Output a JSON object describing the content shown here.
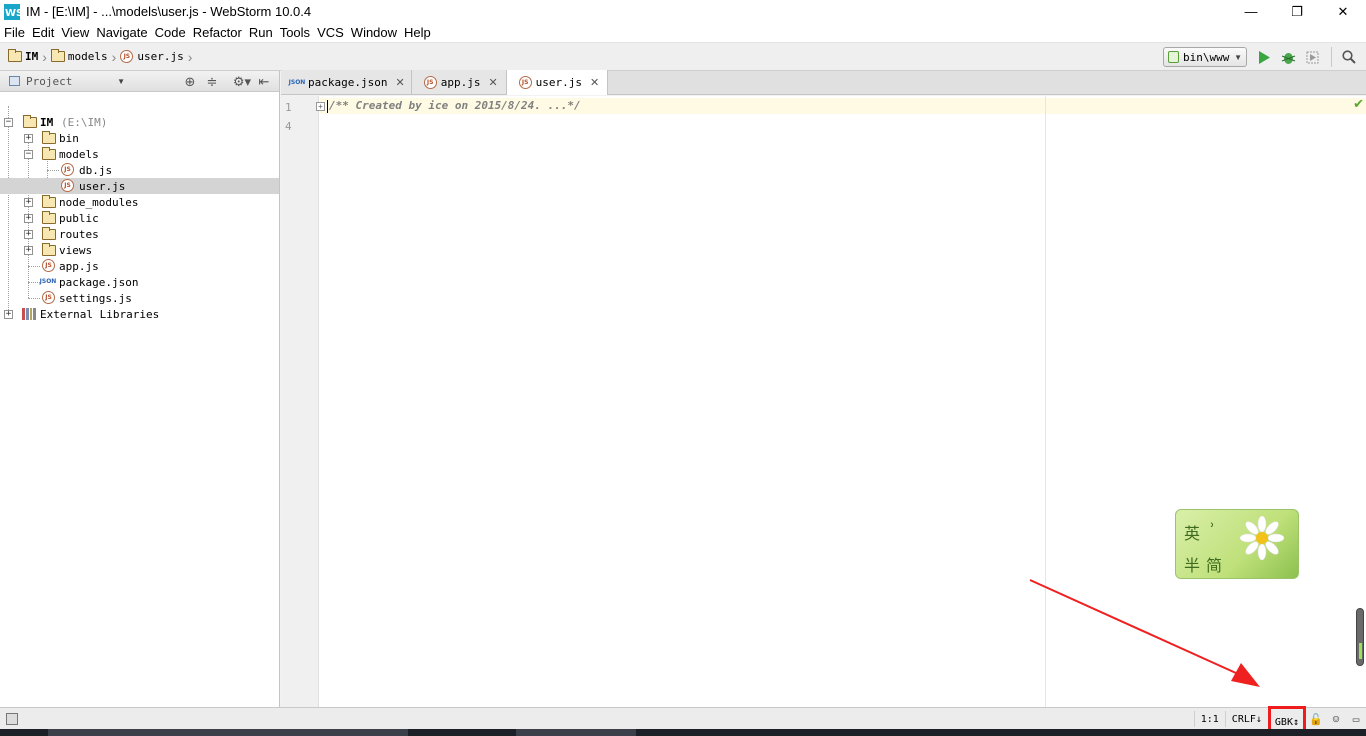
{
  "window": {
    "title": "IM - [E:\\IM] - ...\\models\\user.js - WebStorm 10.0.4",
    "controls": {
      "minimize": "—",
      "restore": "❐",
      "close": "✕"
    }
  },
  "menu": [
    "File",
    "Edit",
    "View",
    "Navigate",
    "Code",
    "Refactor",
    "Run",
    "Tools",
    "VCS",
    "Window",
    "Help"
  ],
  "breadcrumb": [
    "IM",
    "models",
    "user.js"
  ],
  "run_config": {
    "label": "bin\\www"
  },
  "project_panel": {
    "view_label": "Project",
    "tree": [
      {
        "label": "IM",
        "suffix": "(E:\\IM)",
        "type": "folder",
        "depth": 0,
        "expanded": true
      },
      {
        "label": "bin",
        "type": "folder",
        "depth": 1,
        "expanded": false
      },
      {
        "label": "models",
        "type": "folder",
        "depth": 1,
        "expanded": true
      },
      {
        "label": "db.js",
        "type": "js",
        "depth": 2
      },
      {
        "label": "user.js",
        "type": "js",
        "depth": 2,
        "selected": true
      },
      {
        "label": "node_modules",
        "type": "folder",
        "depth": 1,
        "expanded": false
      },
      {
        "label": "public",
        "type": "folder",
        "depth": 1,
        "expanded": false
      },
      {
        "label": "routes",
        "type": "folder",
        "depth": 1,
        "expanded": false
      },
      {
        "label": "views",
        "type": "folder",
        "depth": 1,
        "expanded": false
      },
      {
        "label": "app.js",
        "type": "js",
        "depth": 1
      },
      {
        "label": "package.json",
        "type": "json",
        "depth": 1
      },
      {
        "label": "settings.js",
        "type": "js",
        "depth": 1
      },
      {
        "label": "External Libraries",
        "type": "library",
        "depth": 0,
        "expanded": false
      }
    ]
  },
  "tabs": [
    {
      "label": "package.json",
      "type": "json",
      "active": false
    },
    {
      "label": "app.js",
      "type": "js",
      "active": false
    },
    {
      "label": "user.js",
      "type": "js",
      "active": true
    }
  ],
  "editor": {
    "lines": [
      {
        "number": "1",
        "text": "/** Created by ice on 2015/8/24. ...*/"
      },
      {
        "number": "4",
        "text": ""
      }
    ]
  },
  "ime": {
    "chars": [
      "英",
      "ʾ",
      "半",
      "简"
    ]
  },
  "status": {
    "position": "1:1",
    "line_separator": "CRLF↓",
    "encoding": "GBK↕"
  },
  "colors": {
    "highlight_box": "#ee1c1c",
    "arrow": "#ee2020",
    "ok_check": "#58a82b"
  }
}
